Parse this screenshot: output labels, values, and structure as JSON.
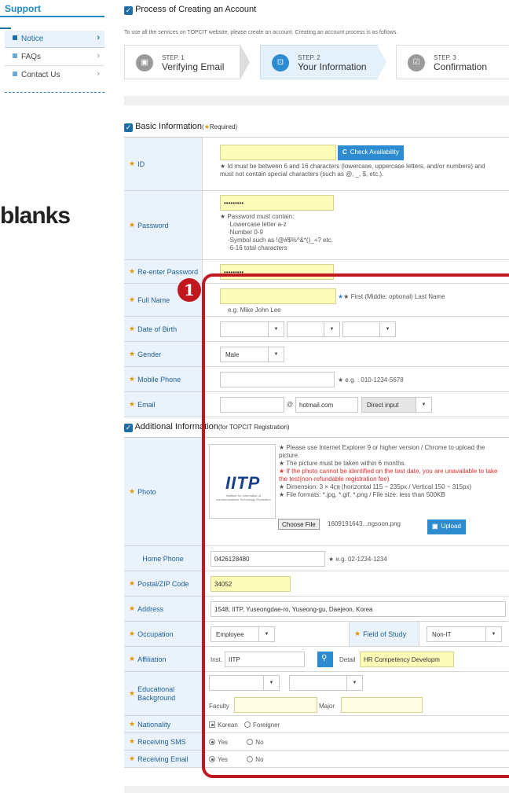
{
  "sidebar": {
    "title": "Support",
    "items": [
      {
        "label": "Notice",
        "active": true
      },
      {
        "label": "FAQs",
        "active": false
      },
      {
        "label": "Contact Us",
        "active": false
      }
    ]
  },
  "overlay": {
    "blanks_text": "blanks",
    "badge": "1"
  },
  "process": {
    "title": "Process of Creating an Account",
    "description": "To use all the services on TOPCIT website, please create an account. Creating an account process is as follows.",
    "steps": [
      {
        "step": "STEP. 1",
        "name": "Verifying Email"
      },
      {
        "step": "STEP. 2",
        "name": "Your Information"
      },
      {
        "step": "STEP. 3",
        "name": "Confirmation"
      }
    ]
  },
  "basic": {
    "title": "Basic Information",
    "required_note": "Required",
    "required_mark": "★",
    "id": {
      "label": "ID",
      "button": "Check Availability",
      "hint": "★ Id must be between 6 and 16 characters (lowercase, uppercase letters, and/or numbers) and must not contain special characters (such as @, _, $, etc.)."
    },
    "password": {
      "label": "Password",
      "value": "•••••••••",
      "hint_title": "★ Password must contain:",
      "hint_lines": [
        "·Lowercase letter a-z",
        "·Number 0-9",
        "·Symbol such as !@#$%^&*()_+? etc.",
        "·6-16 total characters"
      ]
    },
    "reenter": {
      "label": "Re-enter Password",
      "value": "•••••••••"
    },
    "fullname": {
      "label": "Full Name",
      "hint": "★ First (Middle: optional) Last Name",
      "example": "e.g. Mike John Lee"
    },
    "dob": {
      "label": "Date of Birth"
    },
    "gender": {
      "label": "Gender",
      "value": "Male"
    },
    "mobile": {
      "label": "Mobile Phone",
      "hint": "★ e.g. : 010-1234-5678"
    },
    "email": {
      "label": "Email",
      "at": "@",
      "domain": "hotmail.com",
      "select": "Direct input"
    }
  },
  "additional": {
    "title": "Additional Information",
    "sub": "(for TOPCIT Registration)",
    "photo": {
      "label": "Photo",
      "logo": "IITP",
      "logo_sub": "Institute for Information & communications Technology Promotion",
      "hints": [
        "★ Please use Internet Explorer 9 or higher version / Chrome to upload the picture.",
        "★ The picture must be taken within 6 months."
      ],
      "hint_red": "★ If the photo cannot be identified on the test date, you are unavailable to take the test(non-refundable registration fee)",
      "hints2": [
        "★ Dimension: 3 × 4㎝ (horizontal 115 ~ 235px / Vertical 150 ~ 315px)",
        "★ File formats: *.jpg, *.gif, *.png / File size: less than 500KB"
      ],
      "choose": "Choose File",
      "filename": "1609191643...ngsoon.png",
      "upload": "Upload"
    },
    "home_phone": {
      "label": "Home Phone",
      "value": "0426128480",
      "hint": "★ e.g. 02-1234-1234"
    },
    "postal": {
      "label": "Postal/ZIP Code",
      "value": "34052"
    },
    "address": {
      "label": "Address",
      "value": "1548, IITP, Yuseongdae-ro, Yuseong-gu, Daejeon, Korea"
    },
    "occupation": {
      "label": "Occupation",
      "value": "Employee",
      "study_label": "Field of Study",
      "study_value": "Non-IT"
    },
    "affiliation": {
      "label": "Affiliation",
      "inst_label": "Inst.",
      "inst_value": "IITP",
      "detail_label": "Detail",
      "detail_value": "HR Competency Developm"
    },
    "education": {
      "label": "Educational Background",
      "faculty": "Faculty",
      "major": "Major"
    },
    "nationality": {
      "label": "Nationality",
      "options": [
        "Korean",
        "Foreigner"
      ]
    },
    "sms": {
      "label": "Receiving SMS",
      "options": [
        "Yes",
        "No"
      ]
    },
    "email_recv": {
      "label": "Receiving Email",
      "options": [
        "Yes",
        "No"
      ]
    }
  },
  "colors": {
    "accent": "#1e6ea7",
    "required": "#e69500",
    "highlight": "#c0181e"
  }
}
